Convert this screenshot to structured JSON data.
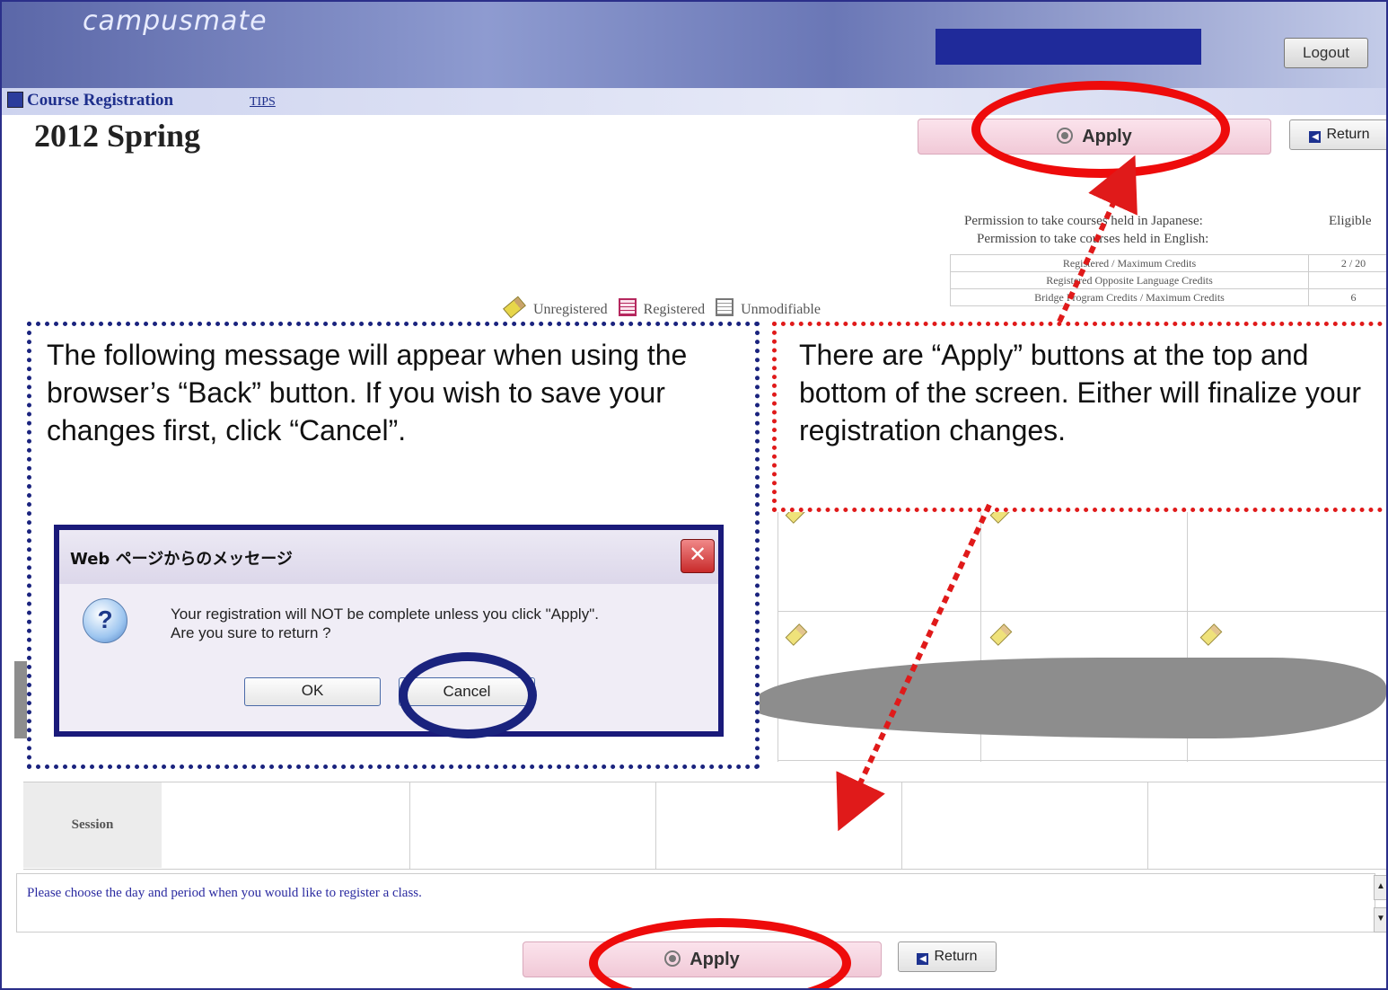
{
  "header": {
    "brand": "campusmate",
    "logout_label": "Logout"
  },
  "titlebar": {
    "title": "Course Registration",
    "tips_link": "TIPS"
  },
  "term": "2012 Spring",
  "actions": {
    "apply_label": "Apply",
    "return_label": "Return"
  },
  "permissions": {
    "japanese_label": "Permission to take courses held in Japanese:",
    "japanese_value": "Eligible",
    "english_label": "Permission to take courses held in English:"
  },
  "credits": [
    {
      "label": "Registered / Maximum Credits",
      "value": "2 / 20"
    },
    {
      "label": "Registered Opposite Language Credits",
      "value": ""
    },
    {
      "label": "Bridge Program Credits / Maximum Credits",
      "value": "6"
    }
  ],
  "legend": {
    "unregistered": "Unregistered",
    "registered": "Registered",
    "unmodifiable": "Unmodifiable"
  },
  "callouts": {
    "left": "The following message will appear when using the browser’s “Back” button. If you wish to save your changes first, click “Cancel”.",
    "right": "There are “Apply” buttons at the top and bottom of the screen. Either will finalize your registration changes."
  },
  "dialog": {
    "title": "Web ページからのメッセージ",
    "line1": "Your registration will NOT be complete unless you click \"Apply\".",
    "line2": "Are you sure to return ?",
    "ok_label": "OK",
    "cancel_label": "Cancel"
  },
  "session_label": "Session",
  "message": "Please choose the day and period when you would like to register a class.",
  "colors": {
    "callout_left_border": "#1a237e",
    "callout_right_border": "#e01a1a",
    "highlight_red": "#ee0b0b",
    "header_blue": "#5b67a8"
  },
  "icons": {
    "course_registration": "course-registration-icon",
    "unregistered": "pencil-icon",
    "registered": "registered-table-icon",
    "unmodifiable": "unmodifiable-table-icon",
    "dialog": "question-icon",
    "close": "close-icon",
    "return": "return-arrow-icon"
  }
}
